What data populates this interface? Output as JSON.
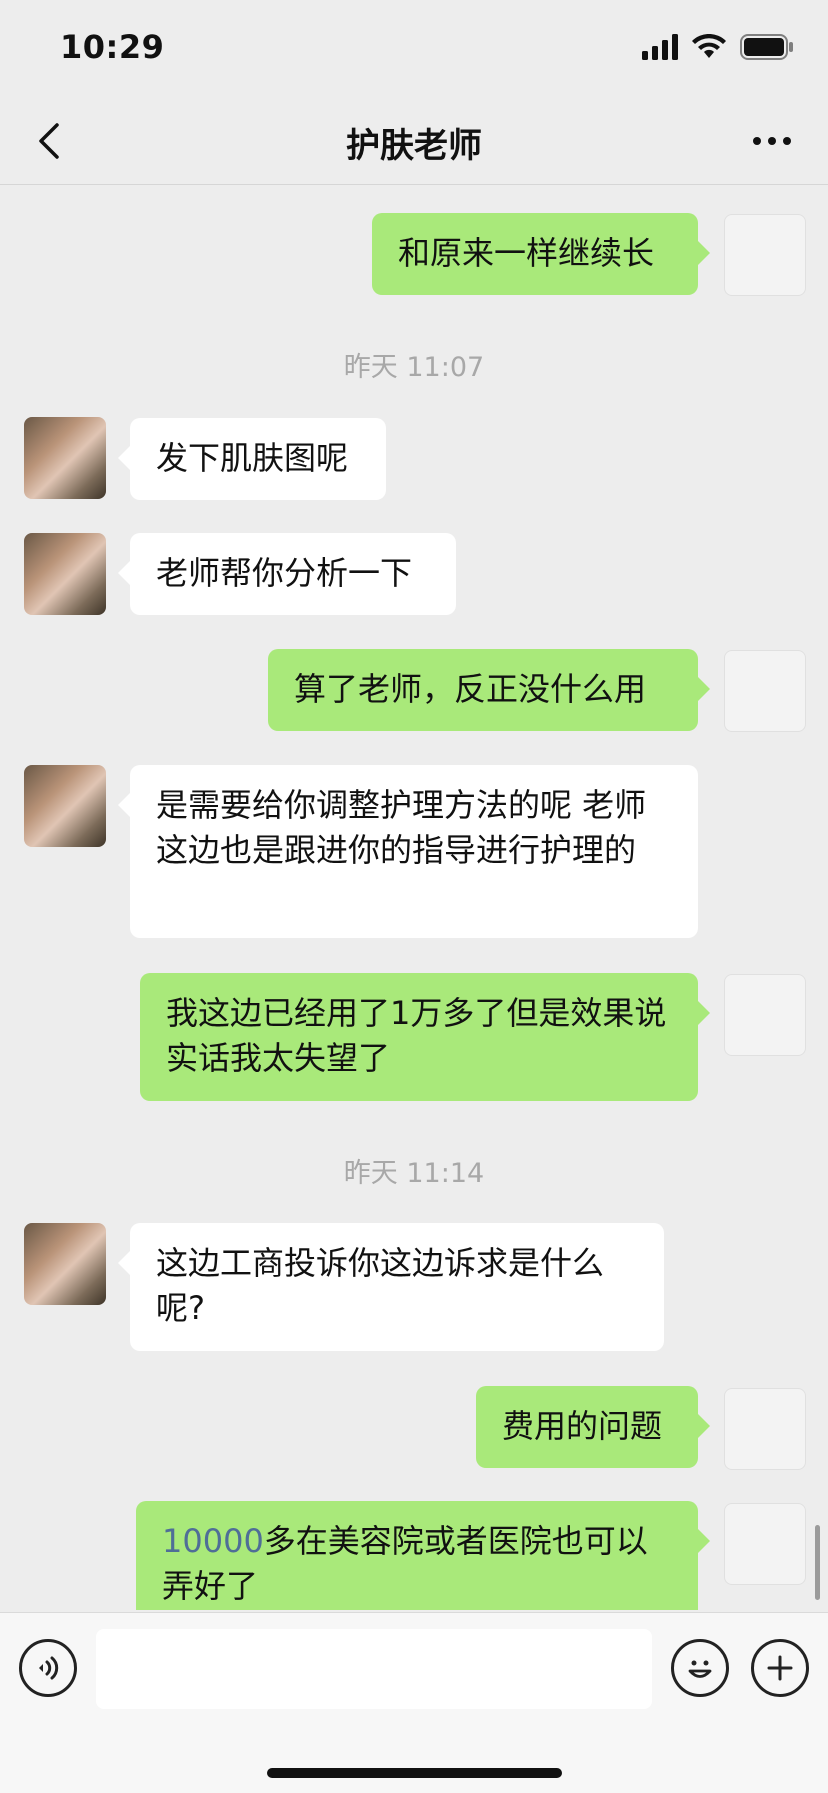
{
  "status_bar": {
    "time": "10:29"
  },
  "header": {
    "title": "护肤老师"
  },
  "messages": [
    {
      "text": "和原来一样继续长"
    },
    {
      "text": "昨天 11:07"
    },
    {
      "text": "发下肌肤图呢"
    },
    {
      "text": "老师帮你分析一下"
    },
    {
      "text": "算了老师，反正没什么用"
    },
    {
      "text": "是需要给你调整护理方法的呢 老师这边也是跟进你的指导进行护理的"
    },
    {
      "text": "我这边已经用了1万多了但是效果说实话我太失望了"
    },
    {
      "text": "昨天 11:14"
    },
    {
      "text": "这边工商投诉你这边诉求是什么呢?"
    },
    {
      "text": "费用的问题"
    },
    {
      "link": "10000",
      "text": "多在美容院或者医院也可以弄好了"
    }
  ],
  "input": {
    "value": ""
  },
  "colors": {
    "sent_bubble": "#A9E97A",
    "received_bubble": "#FFFFFF",
    "background": "#EDEDED",
    "link": "#4F6E97"
  },
  "icons": [
    "back-icon",
    "more-icon",
    "voice-icon",
    "emoji-icon",
    "plus-icon",
    "signal-icon",
    "wifi-icon",
    "battery-icon"
  ]
}
